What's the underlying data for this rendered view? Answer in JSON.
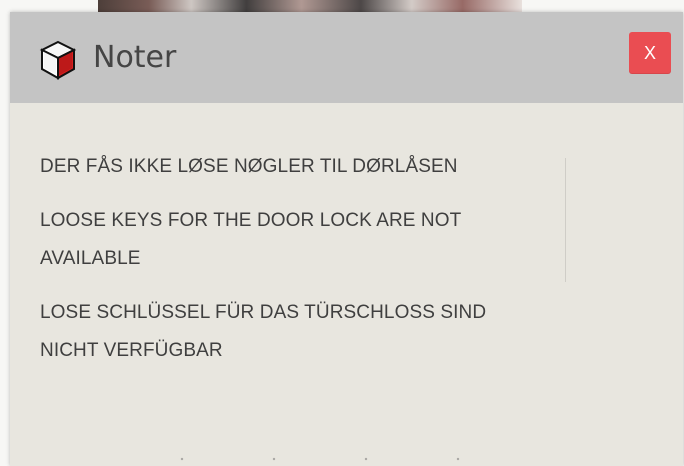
{
  "dialog": {
    "title": "Noter",
    "close_label": "X",
    "icon": "cube-icon"
  },
  "notes": [
    {
      "text": "DER FÅS IKKE LØSE NØGLER TIL DØRLÅSEN"
    },
    {
      "line1": "LOOSE KEYS FOR THE DOOR LOCK ARE NOT",
      "line2": "AVAILABLE"
    },
    {
      "line1": "LOSE SCHLÜSSEL FÜR DAS TÜRSCHLOSS SIND",
      "line2": "NICHT VERFÜGBAR"
    }
  ],
  "colors": {
    "header_bg": "#c4c4c4",
    "body_bg": "#e8e6df",
    "close_bg": "#ea4d52",
    "text": "#3f3f3f"
  }
}
